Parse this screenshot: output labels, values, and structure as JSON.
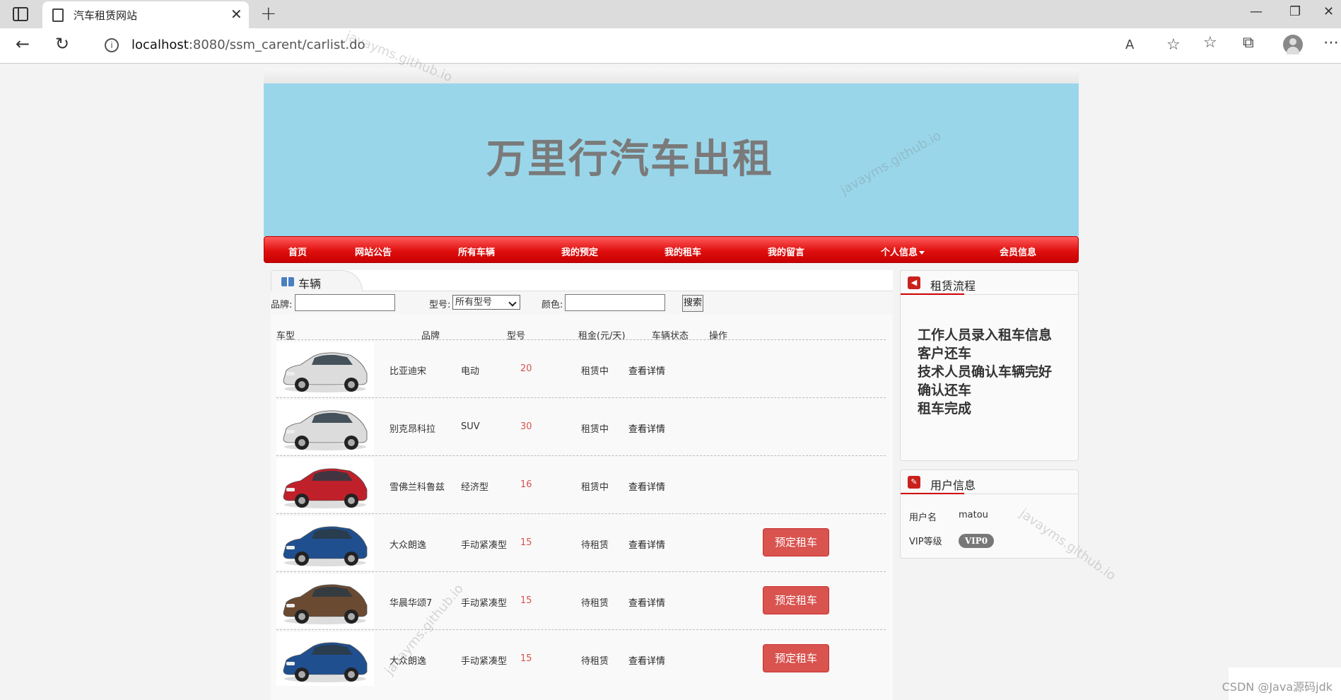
{
  "browser": {
    "tab_title": "汽车租赁网站",
    "url_host": "localhost",
    "url_path": ":8080/ssm_carent/carlist.do",
    "close": "✕",
    "new_tab": "+",
    "minimize": "—",
    "restore": "❐",
    "close_window": "✕"
  },
  "banner": {
    "title": "万里行汽车出租"
  },
  "nav": {
    "items": [
      "首页",
      "网站公告",
      "所有车辆",
      "我的预定",
      "我的租车",
      "我的留言",
      "个人信息",
      "会员信息"
    ]
  },
  "main": {
    "tab_label": "车辆",
    "search": {
      "brand_label": "品牌:",
      "model_label": "型号:",
      "model_value": "所有型号",
      "color_label": "颜色:",
      "search_button": "搜索"
    },
    "columns": [
      "车型",
      "品牌",
      "型号",
      "租金(元/天)",
      "车辆状态",
      "操作"
    ],
    "rows": [
      {
        "brand": "比亚迪宋",
        "model": "电动",
        "rent": "20",
        "status": "租赁中",
        "detail": "查看详情",
        "book": null,
        "car_color": "#dcdcdc"
      },
      {
        "brand": "别克昂科拉",
        "model": "SUV",
        "rent": "30",
        "status": "租赁中",
        "detail": "查看详情",
        "book": null,
        "car_color": "#dcdcdc"
      },
      {
        "brand": "雪佛兰科鲁兹",
        "model": "经济型",
        "rent": "16",
        "status": "租赁中",
        "detail": "查看详情",
        "book": null,
        "car_color": "#c0202a"
      },
      {
        "brand": "大众朗逸",
        "model": "手动紧凑型",
        "rent": "15",
        "status": "待租赁",
        "detail": "查看详情",
        "book": "预定租车",
        "car_color": "#1f4f8f"
      },
      {
        "brand": "华晨华颂7",
        "model": "手动紧凑型",
        "rent": "15",
        "status": "待租赁",
        "detail": "查看详情",
        "book": "预定租车",
        "car_color": "#6b4a32"
      },
      {
        "brand": "大众朗逸",
        "model": "手动紧凑型",
        "rent": "15",
        "status": "待租赁",
        "detail": "查看详情",
        "book": "预定租车",
        "car_color": "#1f4f8f"
      }
    ]
  },
  "process": {
    "title": "租赁流程",
    "steps": [
      "工作人员录入租车信息",
      "客户还车",
      "技术人员确认车辆完好",
      "确认还车",
      "租车完成"
    ]
  },
  "user": {
    "title": "用户信息",
    "name_label": "用户名",
    "name_value": "matou",
    "vip_label": "VIP等级",
    "vip_value": "VIP0"
  },
  "watermark": "javayms.github.io",
  "footer": "CSDN @Java源码jdk",
  "colors": {
    "banner": "#9ad6ea",
    "nav": "#e01010",
    "book_button": "#d9534f",
    "price": "#d9534f"
  }
}
